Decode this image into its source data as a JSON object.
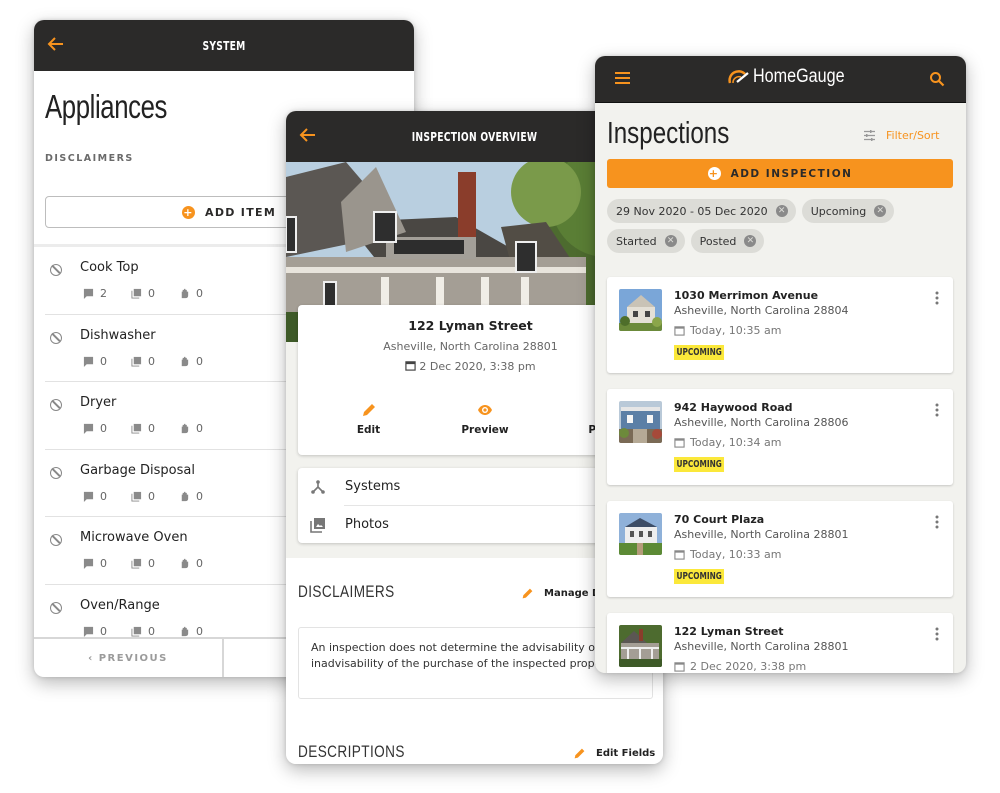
{
  "system_screen": {
    "header_title": "SYSTEM",
    "page_title": "Appliances",
    "disclaimers_label": "DISCLAIMERS",
    "add_item_label": "ADD ITEM",
    "items": [
      {
        "name": "Cook Top",
        "comments": "2",
        "photos": "0",
        "defects": "0"
      },
      {
        "name": "Dishwasher",
        "comments": "0",
        "photos": "0",
        "defects": "0"
      },
      {
        "name": "Dryer",
        "comments": "0",
        "photos": "0",
        "defects": "0"
      },
      {
        "name": "Garbage Disposal",
        "comments": "0",
        "photos": "0",
        "defects": "0"
      },
      {
        "name": "Microwave Oven",
        "comments": "0",
        "photos": "0",
        "defects": "0"
      },
      {
        "name": "Oven/Range",
        "comments": "0",
        "photos": "0",
        "defects": "0"
      }
    ],
    "previous_label": "‹ PREVIOUS"
  },
  "overview_screen": {
    "header_title": "INSPECTION OVERVIEW",
    "street": "122 Lyman Street",
    "city": "Asheville, North Carolina 28801",
    "datetime": "2 Dec 2020, 3:38 pm",
    "actions": [
      {
        "label": "Edit",
        "icon": "pencil-icon"
      },
      {
        "label": "Preview",
        "icon": "eye-icon"
      },
      {
        "label": "Pu",
        "icon": "publish-icon"
      }
    ],
    "nav": [
      {
        "label": "Systems",
        "icon": "systems-icon"
      },
      {
        "label": "Photos",
        "icon": "photos-icon"
      }
    ],
    "disclaimers_title": "DISCLAIMERS",
    "manage_label": "Manage D",
    "disclaimer_text": "An inspection does not determine the advisability or inadvisability of the purchase of the inspected property.",
    "descriptions_title": "DESCRIPTIONS",
    "edit_fields_label": "Edit Fields"
  },
  "inspections_screen": {
    "brand": "HomeGauge",
    "page_title": "Inspections",
    "filter_label": "Filter/Sort",
    "add_label": "ADD INSPECTION",
    "chips": [
      "29 Nov 2020 - 05 Dec 2020",
      "Upcoming",
      "Started",
      "Posted"
    ],
    "inspections": [
      {
        "street": "1030 Merrimon Avenue",
        "city": "Asheville, North Carolina 28804",
        "datetime": "Today, 10:35 am",
        "status": "UPCOMING"
      },
      {
        "street": "942 Haywood Road",
        "city": "Asheville, North Carolina 28806",
        "datetime": "Today, 10:34 am",
        "status": "UPCOMING"
      },
      {
        "street": "70 Court Plaza",
        "city": "Asheville, North Carolina 28801",
        "datetime": "Today, 10:33 am",
        "status": "UPCOMING"
      },
      {
        "street": "122 Lyman Street",
        "city": "Asheville, North Carolina 28801",
        "datetime": "2 Dec 2020, 3:38 pm",
        "status": ""
      }
    ]
  },
  "colors": {
    "accent": "#f7931e",
    "appbar": "#2b2a29",
    "badge": "#fbe83a",
    "background": "#f2f2ee"
  }
}
